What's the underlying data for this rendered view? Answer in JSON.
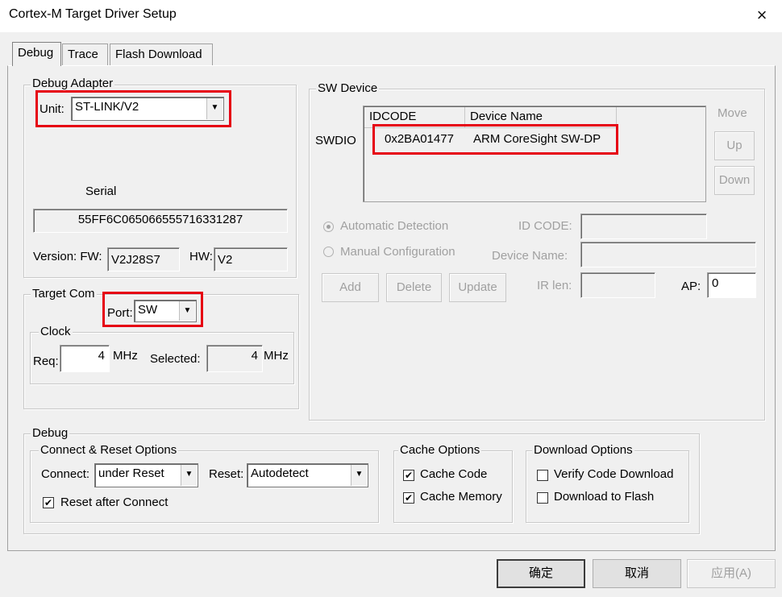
{
  "window": {
    "title": "Cortex-M Target Driver Setup",
    "close_symbol": "×"
  },
  "tabs": [
    "Debug",
    "Trace",
    "Flash Download"
  ],
  "debug_adapter": {
    "group_label": "Debug Adapter",
    "unit_label": "Unit:",
    "unit_value": "ST-LINK/V2",
    "serial_label": "Serial",
    "serial_value": "55FF6C065066555716331287",
    "version_label": "Version: FW:",
    "fw_value": "V2J28S7",
    "hw_label": "HW:",
    "hw_value": "V2"
  },
  "target_com": {
    "group_label": "Target Com",
    "port_label": "Port:",
    "port_value": "SW",
    "clock_label": "Clock",
    "req_label": "Req:",
    "req_value": "4",
    "req_unit": "MHz",
    "selected_label": "Selected:",
    "selected_value": "4",
    "selected_unit": "MHz"
  },
  "sw_device": {
    "group_label": "SW Device",
    "swdio_label": "SWDIO",
    "columns": [
      "IDCODE",
      "Device Name"
    ],
    "rows": [
      {
        "idcode": "0x2BA01477",
        "device_name": "ARM CoreSight SW-DP"
      }
    ],
    "move_label": "Move",
    "up_button": "Up",
    "down_button": "Down",
    "automatic_detection": "Automatic Detection",
    "manual_configuration": "Manual Configuration",
    "id_code_label": "ID CODE:",
    "device_name_label": "Device Name:",
    "add_button": "Add",
    "delete_button": "Delete",
    "update_button": "Update",
    "ir_len_label": "IR len:",
    "ap_label": "AP:",
    "ap_value": "0"
  },
  "debug": {
    "group_label": "Debug",
    "connect_reset": {
      "group_label": "Connect & Reset Options",
      "connect_label": "Connect:",
      "connect_value": "under Reset",
      "reset_label": "Reset:",
      "reset_value": "Autodetect",
      "reset_after_connect": "Reset after Connect"
    },
    "cache": {
      "group_label": "Cache Options",
      "cache_code": "Cache Code",
      "cache_memory": "Cache Memory"
    },
    "download": {
      "group_label": "Download Options",
      "verify_code_download": "Verify Code Download",
      "download_to_flash": "Download to Flash"
    }
  },
  "checkmark": "✔",
  "dropdown_arrow": "▼",
  "footer": {
    "ok": "确定",
    "cancel": "取消",
    "apply": "应用(A)"
  },
  "colors": {
    "highlight_red": "#e60012",
    "dialog_bg": "#f0f0f0"
  }
}
